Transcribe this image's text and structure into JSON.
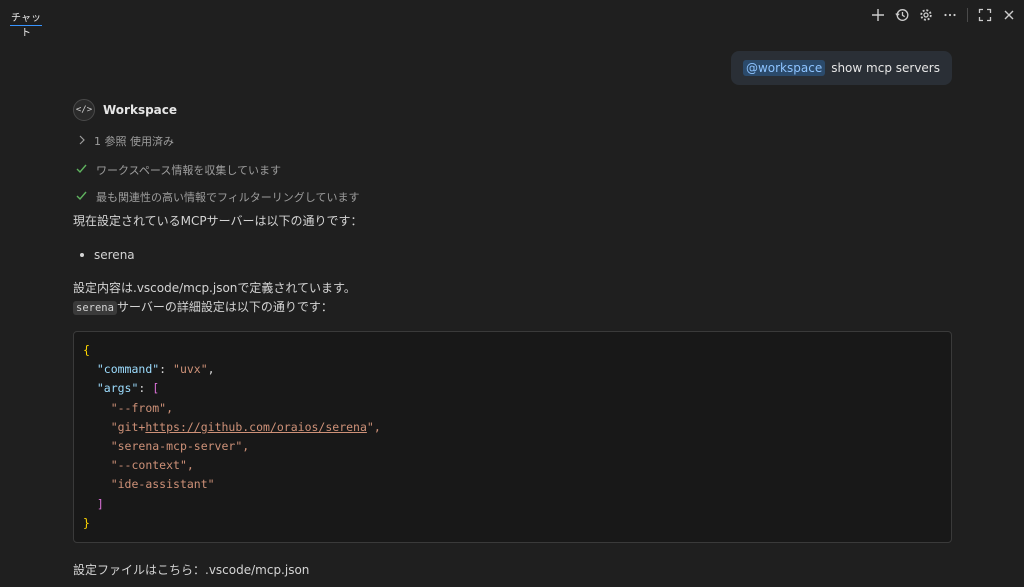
{
  "header": {
    "tab_label": "チャット"
  },
  "toolbar": {
    "icons": [
      "plus-icon",
      "history-icon",
      "gear-icon",
      "more-icon",
      "maximize-icon",
      "close-icon"
    ]
  },
  "user_message": {
    "mention": "@workspace",
    "text": "show mcp servers"
  },
  "agent": {
    "avatar_glyph": "</>",
    "name": "Workspace"
  },
  "references": {
    "label": "1 参照 使用済み"
  },
  "progress": [
    {
      "label": "ワークスペース情報を収集しています"
    },
    {
      "label": "最も関連性の高い情報でフィルターリングしています"
    }
  ],
  "response": {
    "intro": "現在設定されているMCPサーバーは以下の通りです：",
    "servers": [
      "serena"
    ],
    "defined_in": "設定内容は.vscode/mcp.jsonで定義されています。",
    "detail_code": "serena",
    "detail_rest": "サーバーの詳細設定は以下の通りです：",
    "code": {
      "open_brace": "{",
      "command_key": "\"command\"",
      "command_value": "\"uvx\"",
      "args_key": "\"args\"",
      "open_bracket": "[",
      "args": [
        "\"--from\",",
        "\"git+",
        "https://github.com/oraios/serena",
        "\",",
        "\"serena-mcp-server\",",
        "\"--context\",",
        "\"ide-assistant\""
      ],
      "close_bracket": "]",
      "close_brace": "}"
    },
    "footer": "設定ファイルはこちら：.vscode/mcp.json"
  }
}
